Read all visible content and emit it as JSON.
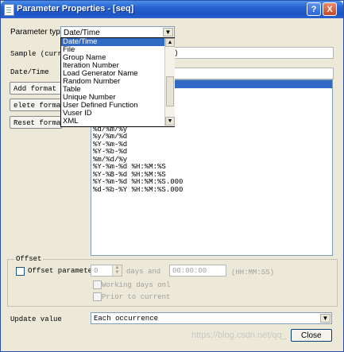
{
  "window": {
    "title": "Parameter Properties - [seq]",
    "help_glyph": "?",
    "close_glyph": "X"
  },
  "param_type": {
    "label": "Parameter type:",
    "value": "Date/Time"
  },
  "dropdown_options": [
    "Date/Time",
    "File",
    "Group Name",
    "Iteration Number",
    "Load Generator Name",
    "Random Number",
    "Table",
    "Unique Number",
    "User Defined Function",
    "Vuser ID",
    "XML"
  ],
  "sample": {
    "label": "Sample (curren",
    "trailing": ")"
  },
  "datetime_label": "Date/Time",
  "buttons": {
    "add_format": "Add format ->",
    "delete_format": "elete format",
    "reset_formats": "Reset formats",
    "close": "Close"
  },
  "formats": [
    "%d/%m/%y",
    "%y/%m/%d",
    "%Y-%m-%d",
    "%Y-%b-%d",
    "%m/%d/%y",
    "%Y-%m-%d %H:%M:%S",
    "%Y-%B-%d %H:%M:%S",
    "%Y-%m-%d %H:%M:%S.000",
    "%d-%b-%Y %H:%M:%S.000"
  ],
  "offset": {
    "group_label": "Offset",
    "offset_parameter_label": "Offset parameter",
    "days_value": "0",
    "days_and_label": "days and",
    "time_value": "00:00:00",
    "time_format": "(HH:MM:SS)",
    "working_days_label": "Working days onl",
    "prior_label": "Prior to current"
  },
  "update_value": {
    "label": "Update value",
    "value": "Each occurrence"
  },
  "watermark": "https://blog.csdn.net/qq_"
}
